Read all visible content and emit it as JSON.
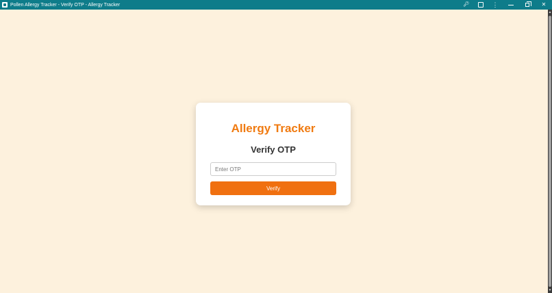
{
  "window": {
    "title": "Pollen Allergy Tracker - Verify OTP - Allergy Tracker",
    "icons": {
      "app": "app-icon",
      "password": "key-icon",
      "extensions": "extension-icon",
      "menu": "more-vert-icon",
      "minimize": "minimize-icon",
      "restore": "restore-icon",
      "close": "close-icon"
    }
  },
  "card": {
    "brand": "Allergy Tracker",
    "title": "Verify OTP",
    "otp_placeholder": "Enter OTP",
    "otp_value": "",
    "verify_label": "Verify"
  },
  "colors": {
    "titlebar": "#0e7c8a",
    "background": "#fdf1dd",
    "brand": "#f07a10",
    "button": "#f07010"
  }
}
